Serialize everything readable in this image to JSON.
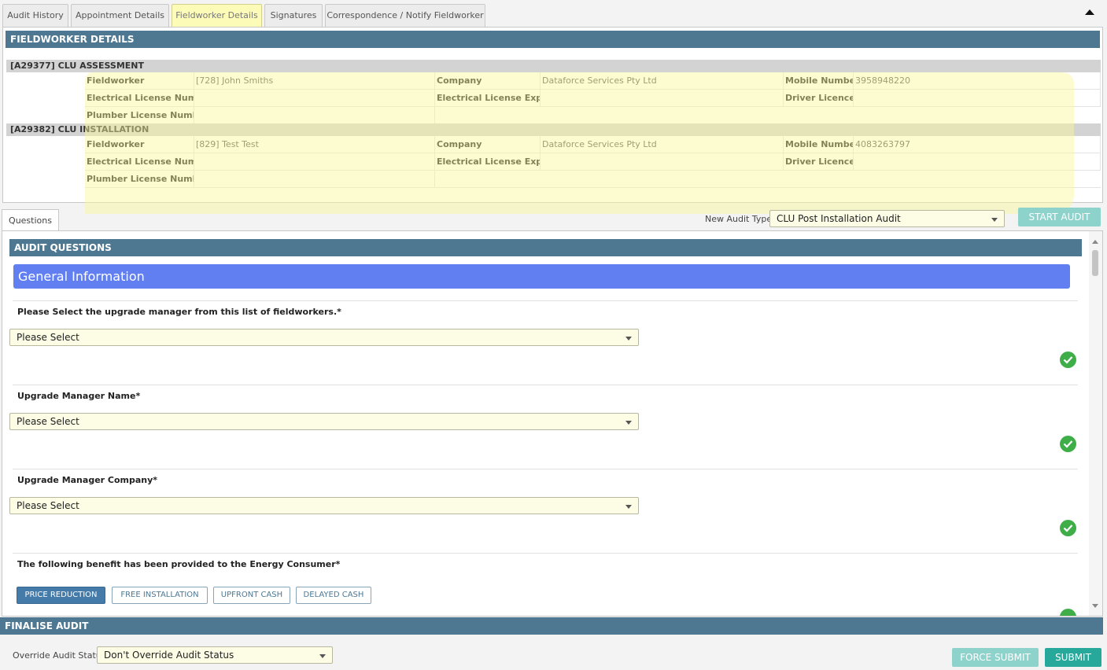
{
  "tabs": [
    {
      "label": "Audit History"
    },
    {
      "label": "Appointment Details"
    },
    {
      "label": "Fieldworker Details"
    },
    {
      "label": "Signatures"
    },
    {
      "label": "Correspondence / Notify Fieldworker"
    }
  ],
  "fieldworker_details": {
    "title": "FIELDWORKER DETAILS",
    "labels": {
      "fieldworker": "Fieldworker",
      "company": "Company",
      "mobile": "Mobile Number",
      "electrical_license": "Electrical License Number",
      "electrical_expires": "Electrical License Expires",
      "driver_licence": "Driver Licence",
      "plumber_license": "Plumber License Number"
    },
    "groups": [
      {
        "title": "[A29377] CLU ASSESSMENT",
        "fieldworker": "[728] John Smiths",
        "company": "Dataforce Services Pty Ltd",
        "mobile": "3958948220",
        "electrical_license": "",
        "electrical_expires": "",
        "driver_licence": "",
        "plumber_license": ""
      },
      {
        "title": "[A29382] CLU INSTALLATION",
        "fieldworker": "[829] Test Test",
        "company": "Dataforce Services Pty Ltd",
        "mobile": "4083263797",
        "electrical_license": "",
        "electrical_expires": "",
        "driver_licence": "",
        "plumber_license": ""
      }
    ]
  },
  "questions_tab": {
    "label": "Questions"
  },
  "audit_type": {
    "label": "New Audit Type:",
    "value": "CLU Post Installation Audit"
  },
  "start_audit": {
    "label": "START AUDIT"
  },
  "audit_questions": {
    "title": "AUDIT QUESTIONS",
    "section": "General Information",
    "questions": [
      {
        "label": "Please Select the upgrade manager from this list of fieldworkers.*",
        "value": "Please Select"
      },
      {
        "label": "Upgrade Manager Name*",
        "value": "Please Select"
      },
      {
        "label": "Upgrade Manager Company*",
        "value": "Please Select"
      },
      {
        "label": "The following benefit has been provided to the Energy Consumer*"
      }
    ],
    "benefit_options": [
      {
        "label": "PRICE REDUCTION",
        "selected": true
      },
      {
        "label": "FREE INSTALLATION",
        "selected": false
      },
      {
        "label": "UPFRONT CASH",
        "selected": false
      },
      {
        "label": "DELAYED CASH",
        "selected": false
      }
    ]
  },
  "finalise": {
    "title": "FINALISE AUDIT",
    "override_label": "Override Audit Status",
    "override_value": "Don't Override Audit Status",
    "force_submit": "FORCE SUBMIT",
    "submit": "SUBMIT"
  },
  "colors": {
    "header": "#4e7892",
    "section": "#617ff0",
    "highlight": "#fdfbb8",
    "teal": "#26a99a",
    "teal_disabled": "#8ed3cb",
    "check": "#3fae49"
  }
}
